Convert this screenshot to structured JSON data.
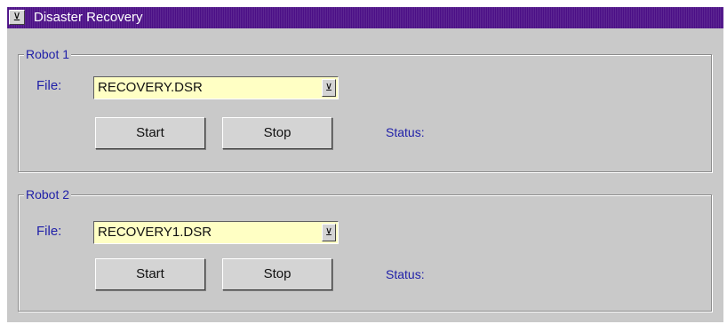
{
  "window": {
    "title": "Disaster Recovery",
    "menu_icon": "minimize-arrow-icon",
    "title_color": "#4b0f86"
  },
  "robots": [
    {
      "group_label": "Robot 1",
      "file_label": "File:",
      "file_value": "RECOVERY.DSR",
      "start_label": "Start",
      "stop_label": "Stop",
      "status_label": "Status:"
    },
    {
      "group_label": "Robot 2",
      "file_label": "File:",
      "file_value": "RECOVERY1.DSR",
      "start_label": "Start",
      "stop_label": "Stop",
      "status_label": "Status:"
    }
  ],
  "colors": {
    "panel": "#c9c9c9",
    "label_text": "#1f1fa8",
    "file_field": "#ffffc4"
  }
}
